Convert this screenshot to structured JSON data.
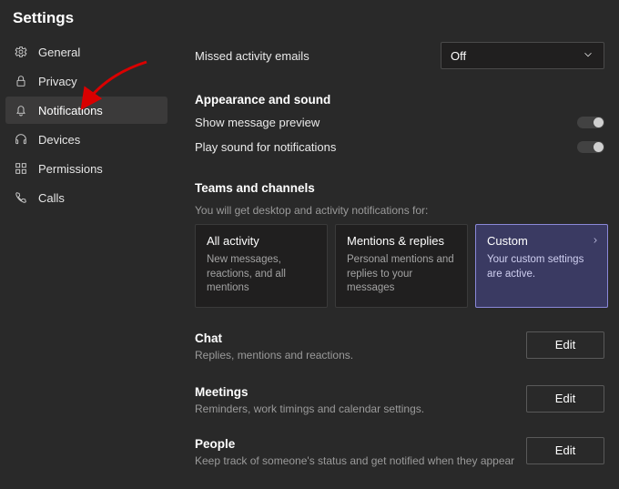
{
  "window": {
    "title": "Settings"
  },
  "sidebar": {
    "items": [
      {
        "label": "General"
      },
      {
        "label": "Privacy"
      },
      {
        "label": "Notifications"
      },
      {
        "label": "Devices"
      },
      {
        "label": "Permissions"
      },
      {
        "label": "Calls"
      }
    ]
  },
  "missed": {
    "label": "Missed activity emails",
    "value": "Off"
  },
  "appearance": {
    "heading": "Appearance and sound",
    "preview_label": "Show message preview",
    "sound_label": "Play sound for notifications"
  },
  "teams_channels": {
    "heading": "Teams and channels",
    "sub": "You will get desktop and activity notifications for:",
    "cards": [
      {
        "title": "All activity",
        "desc": "New messages, reactions, and all mentions"
      },
      {
        "title": "Mentions & replies",
        "desc": "Personal mentions and replies to your messages"
      },
      {
        "title": "Custom",
        "desc": "Your custom settings are active."
      }
    ]
  },
  "chat": {
    "heading": "Chat",
    "desc": "Replies, mentions and reactions.",
    "button": "Edit"
  },
  "meetings": {
    "heading": "Meetings",
    "desc": "Reminders, work timings and calendar settings.",
    "button": "Edit"
  },
  "people": {
    "heading": "People",
    "desc": "Keep track of someone's status and get notified when they appear",
    "button": "Edit"
  }
}
